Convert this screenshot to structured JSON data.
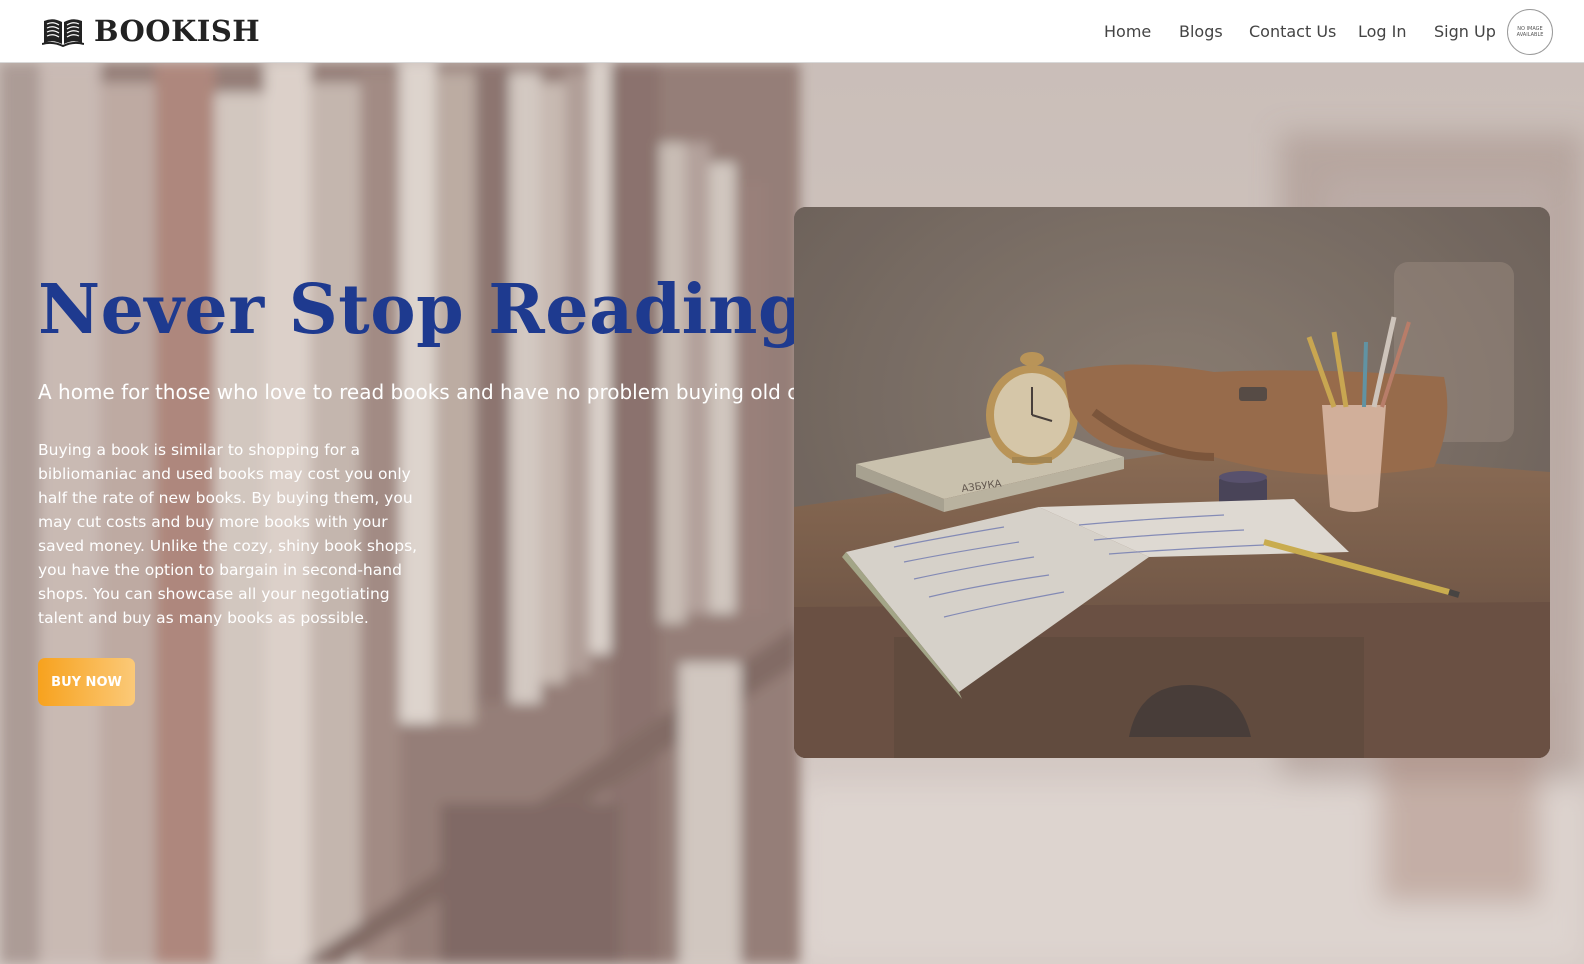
{
  "navbar": {
    "brand": "BOOKISH",
    "brand_icon": "open-book-icon",
    "links": {
      "home": "Home",
      "blogs": "Blogs",
      "contact": "Contact Us",
      "login": "Log In",
      "signup": "Sign Up"
    },
    "avatar": {
      "line1": "NO IMAGE",
      "line2": "AVAILABLE"
    }
  },
  "hero": {
    "title": "Never Stop Reading",
    "subtitle": "A home for those who love to read books and have no problem buying old ones.",
    "body": "Buying a book is similar to shopping for a bibliomaniac and used books may cost you only half the rate of new books. By buying them, you may cut costs and buy more books with your saved money. Unlike the cozy, shiny book shops, you have the option to bargain in second-hand shops. You can showcase all your negotiating talent and buy as many books as possible.",
    "cta_label": "BUY NOW",
    "book_spine_text": "АЗБУКА"
  },
  "colors": {
    "title": "#1e3a8f",
    "cta_start": "#f7a21e",
    "cta_end": "#fbc978"
  }
}
